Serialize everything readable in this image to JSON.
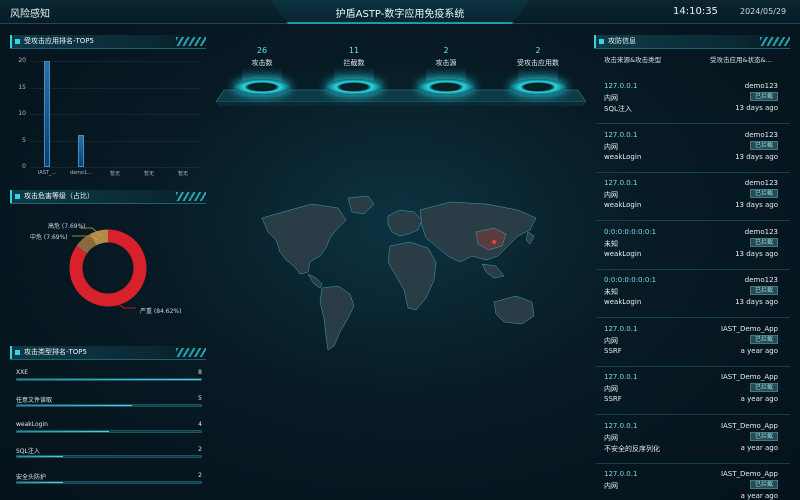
{
  "header": {
    "left_title": "风险感知",
    "center_title": "护盾ASTP-数字应用免疫系统",
    "time": "14:10:35",
    "date": "2024/05/29"
  },
  "top5_apps": {
    "title": "受攻击应用排名-TOP5",
    "y_ticks": [
      "20",
      "15",
      "10",
      "5",
      "0"
    ]
  },
  "chart_data": [
    {
      "type": "bar",
      "title": "受攻击应用排名-TOP5",
      "categories": [
        "IAST_...",
        "demo1...",
        "暂无",
        "暂无",
        "暂无"
      ],
      "values": [
        20,
        6,
        0,
        0,
        0
      ],
      "ylim": [
        0,
        20
      ]
    },
    {
      "type": "pie",
      "title": "攻击危害等级（占比）",
      "labels": [
        "高危",
        "中危",
        "严重"
      ],
      "values": [
        7.69,
        7.69,
        84.62
      ],
      "colors": [
        "#8a6a3a",
        "#b08a4a",
        "#d8212a"
      ]
    }
  ],
  "severity": {
    "title": "攻击危害等级（占比）",
    "labels": [
      "高危 (7.69%)",
      "中危 (7.69%)",
      "严重 (84.62%)"
    ]
  },
  "type_rank": {
    "title": "攻击类型排名-TOP5",
    "items": [
      {
        "name": "XXE",
        "value": 8,
        "fill": 1.0
      },
      {
        "name": "任意文件读取",
        "value": 5,
        "fill": 0.625
      },
      {
        "name": "weakLogin",
        "value": 4,
        "fill": 0.5
      },
      {
        "name": "SQL注入",
        "value": 2,
        "fill": 0.25
      },
      {
        "name": "安全头防护",
        "value": 2,
        "fill": 0.25
      }
    ]
  },
  "stats": [
    {
      "value": "26",
      "label": "攻击数"
    },
    {
      "value": "11",
      "label": "拦截数"
    },
    {
      "value": "2",
      "label": "攻击源"
    },
    {
      "value": "2",
      "label": "受攻击应用数"
    }
  ],
  "attack_info": {
    "title": "攻防信息",
    "col_left": "攻击来源&攻击类型",
    "col_right": "受攻击应用&状态&...",
    "items": [
      {
        "ip": "127.0.0.1",
        "zone": "内网",
        "type": "SQL注入",
        "app": "demo123",
        "status": "已拦截",
        "ago": "13 days ago"
      },
      {
        "ip": "127.0.0.1",
        "zone": "内网",
        "type": "weakLogin",
        "app": "demo123",
        "status": "已拦截",
        "ago": "13 days ago"
      },
      {
        "ip": "127.0.0.1",
        "zone": "内网",
        "type": "weakLogin",
        "app": "demo123",
        "status": "已拦截",
        "ago": "13 days ago"
      },
      {
        "ip": "0:0:0:0:0:0:0:1",
        "zone": "未知",
        "type": "weakLogin",
        "app": "demo123",
        "status": "已拦截",
        "ago": "13 days ago"
      },
      {
        "ip": "0:0:0:0:0:0:0:1",
        "zone": "未知",
        "type": "weakLogin",
        "app": "demo123",
        "status": "已拦截",
        "ago": "13 days ago"
      },
      {
        "ip": "127.0.0.1",
        "zone": "内网",
        "type": "SSRF",
        "app": "IAST_Demo_App",
        "status": "已拦截",
        "ago": "a year ago"
      },
      {
        "ip": "127.0.0.1",
        "zone": "内网",
        "type": "SSRF",
        "app": "IAST_Demo_App",
        "status": "已拦截",
        "ago": "a year ago"
      },
      {
        "ip": "127.0.0.1",
        "zone": "内网",
        "type": "不安全的反序列化",
        "app": "IAST_Demo_App",
        "status": "已拦截",
        "ago": "a year ago"
      },
      {
        "ip": "127.0.0.1",
        "zone": "内网",
        "type": "",
        "app": "IAST_Demo_App",
        "status": "已拦截",
        "ago": "a year ago"
      }
    ]
  },
  "colors": {
    "accent": "#35d6e3",
    "severe": "#d8212a",
    "background": "#071a24"
  }
}
